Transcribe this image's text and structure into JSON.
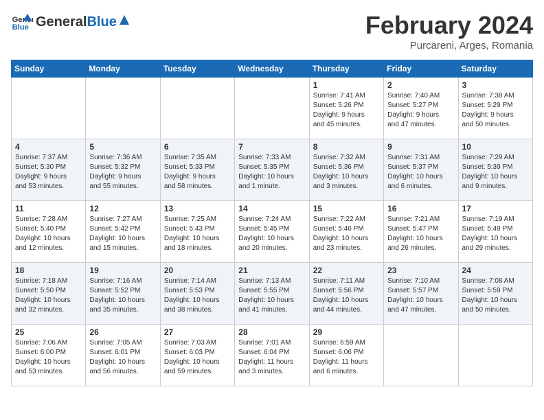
{
  "header": {
    "logo_general": "General",
    "logo_blue": "Blue",
    "month_year": "February 2024",
    "location": "Purcareni, Arges, Romania"
  },
  "days_of_week": [
    "Sunday",
    "Monday",
    "Tuesday",
    "Wednesday",
    "Thursday",
    "Friday",
    "Saturday"
  ],
  "weeks": [
    [
      {
        "day": "",
        "info": ""
      },
      {
        "day": "",
        "info": ""
      },
      {
        "day": "",
        "info": ""
      },
      {
        "day": "",
        "info": ""
      },
      {
        "day": "1",
        "info": "Sunrise: 7:41 AM\nSunset: 5:26 PM\nDaylight: 9 hours\nand 45 minutes."
      },
      {
        "day": "2",
        "info": "Sunrise: 7:40 AM\nSunset: 5:27 PM\nDaylight: 9 hours\nand 47 minutes."
      },
      {
        "day": "3",
        "info": "Sunrise: 7:38 AM\nSunset: 5:29 PM\nDaylight: 9 hours\nand 50 minutes."
      }
    ],
    [
      {
        "day": "4",
        "info": "Sunrise: 7:37 AM\nSunset: 5:30 PM\nDaylight: 9 hours\nand 53 minutes."
      },
      {
        "day": "5",
        "info": "Sunrise: 7:36 AM\nSunset: 5:32 PM\nDaylight: 9 hours\nand 55 minutes."
      },
      {
        "day": "6",
        "info": "Sunrise: 7:35 AM\nSunset: 5:33 PM\nDaylight: 9 hours\nand 58 minutes."
      },
      {
        "day": "7",
        "info": "Sunrise: 7:33 AM\nSunset: 5:35 PM\nDaylight: 10 hours\nand 1 minute."
      },
      {
        "day": "8",
        "info": "Sunrise: 7:32 AM\nSunset: 5:36 PM\nDaylight: 10 hours\nand 3 minutes."
      },
      {
        "day": "9",
        "info": "Sunrise: 7:31 AM\nSunset: 5:37 PM\nDaylight: 10 hours\nand 6 minutes."
      },
      {
        "day": "10",
        "info": "Sunrise: 7:29 AM\nSunset: 5:39 PM\nDaylight: 10 hours\nand 9 minutes."
      }
    ],
    [
      {
        "day": "11",
        "info": "Sunrise: 7:28 AM\nSunset: 5:40 PM\nDaylight: 10 hours\nand 12 minutes."
      },
      {
        "day": "12",
        "info": "Sunrise: 7:27 AM\nSunset: 5:42 PM\nDaylight: 10 hours\nand 15 minutes."
      },
      {
        "day": "13",
        "info": "Sunrise: 7:25 AM\nSunset: 5:43 PM\nDaylight: 10 hours\nand 18 minutes."
      },
      {
        "day": "14",
        "info": "Sunrise: 7:24 AM\nSunset: 5:45 PM\nDaylight: 10 hours\nand 20 minutes."
      },
      {
        "day": "15",
        "info": "Sunrise: 7:22 AM\nSunset: 5:46 PM\nDaylight: 10 hours\nand 23 minutes."
      },
      {
        "day": "16",
        "info": "Sunrise: 7:21 AM\nSunset: 5:47 PM\nDaylight: 10 hours\nand 26 minutes."
      },
      {
        "day": "17",
        "info": "Sunrise: 7:19 AM\nSunset: 5:49 PM\nDaylight: 10 hours\nand 29 minutes."
      }
    ],
    [
      {
        "day": "18",
        "info": "Sunrise: 7:18 AM\nSunset: 5:50 PM\nDaylight: 10 hours\nand 32 minutes."
      },
      {
        "day": "19",
        "info": "Sunrise: 7:16 AM\nSunset: 5:52 PM\nDaylight: 10 hours\nand 35 minutes."
      },
      {
        "day": "20",
        "info": "Sunrise: 7:14 AM\nSunset: 5:53 PM\nDaylight: 10 hours\nand 38 minutes."
      },
      {
        "day": "21",
        "info": "Sunrise: 7:13 AM\nSunset: 5:55 PM\nDaylight: 10 hours\nand 41 minutes."
      },
      {
        "day": "22",
        "info": "Sunrise: 7:11 AM\nSunset: 5:56 PM\nDaylight: 10 hours\nand 44 minutes."
      },
      {
        "day": "23",
        "info": "Sunrise: 7:10 AM\nSunset: 5:57 PM\nDaylight: 10 hours\nand 47 minutes."
      },
      {
        "day": "24",
        "info": "Sunrise: 7:08 AM\nSunset: 5:59 PM\nDaylight: 10 hours\nand 50 minutes."
      }
    ],
    [
      {
        "day": "25",
        "info": "Sunrise: 7:06 AM\nSunset: 6:00 PM\nDaylight: 10 hours\nand 53 minutes."
      },
      {
        "day": "26",
        "info": "Sunrise: 7:05 AM\nSunset: 6:01 PM\nDaylight: 10 hours\nand 56 minutes."
      },
      {
        "day": "27",
        "info": "Sunrise: 7:03 AM\nSunset: 6:03 PM\nDaylight: 10 hours\nand 59 minutes."
      },
      {
        "day": "28",
        "info": "Sunrise: 7:01 AM\nSunset: 6:04 PM\nDaylight: 11 hours\nand 3 minutes."
      },
      {
        "day": "29",
        "info": "Sunrise: 6:59 AM\nSunset: 6:06 PM\nDaylight: 11 hours\nand 6 minutes."
      },
      {
        "day": "",
        "info": ""
      },
      {
        "day": "",
        "info": ""
      }
    ]
  ]
}
